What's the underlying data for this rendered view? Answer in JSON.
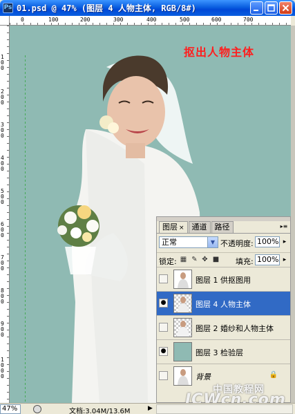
{
  "window": {
    "title": "01.psd @ 47% (图层 4  人物主体, RGB/8#)",
    "app_icon_label": "Ps",
    "minimize_icon": "minimize-icon",
    "maximize_icon": "maximize-icon",
    "close_icon": "close-icon"
  },
  "rulers": {
    "top_ticks": [
      "0",
      "100",
      "200",
      "300",
      "400",
      "500",
      "600",
      "700"
    ],
    "left_ticks": [
      "100",
      "200",
      "300",
      "400",
      "500",
      "600",
      "700",
      "800",
      "900",
      "1000"
    ]
  },
  "canvas": {
    "background": "#8fbab3",
    "caption": "抠出人物主体"
  },
  "layers_panel": {
    "tabs": [
      {
        "label": "图层",
        "has_close": true,
        "close_glyph": "×"
      },
      {
        "label": "通道",
        "has_close": false
      },
      {
        "label": "路径",
        "has_close": false
      }
    ],
    "menu_glyph": "▸≡",
    "blend_mode": "正常",
    "opacity_label": "不透明度:",
    "opacity_value": "100%",
    "lock_label": "锁定:",
    "fill_label": "填充:",
    "fill_value": "100%",
    "layers": [
      {
        "name": "图层 1  供抠图用",
        "visible": false,
        "selected": false,
        "thumb": "bride"
      },
      {
        "name": "图层 4  人物主体",
        "visible": true,
        "selected": true,
        "thumb": "bride-cutout"
      },
      {
        "name": "图层 2  婚纱和人物主体",
        "visible": false,
        "selected": false,
        "thumb": "bride-cutout"
      },
      {
        "name": "图层 3  检验层",
        "visible": true,
        "selected": false,
        "thumb": "teal-fill"
      },
      {
        "name": "背景",
        "visible": false,
        "selected": false,
        "thumb": "bride",
        "locked": true
      }
    ]
  },
  "status_bar": {
    "zoom": "47%",
    "doc_info": "文档:3.04M/13.6M",
    "arrow": "▶"
  },
  "watermark": {
    "line1": "中国教程网",
    "line2": "JCWcn.com"
  },
  "colors": {
    "title_bar": "#0a5fe0",
    "selection": "#316ac5",
    "caption": "#ff1e1e"
  }
}
